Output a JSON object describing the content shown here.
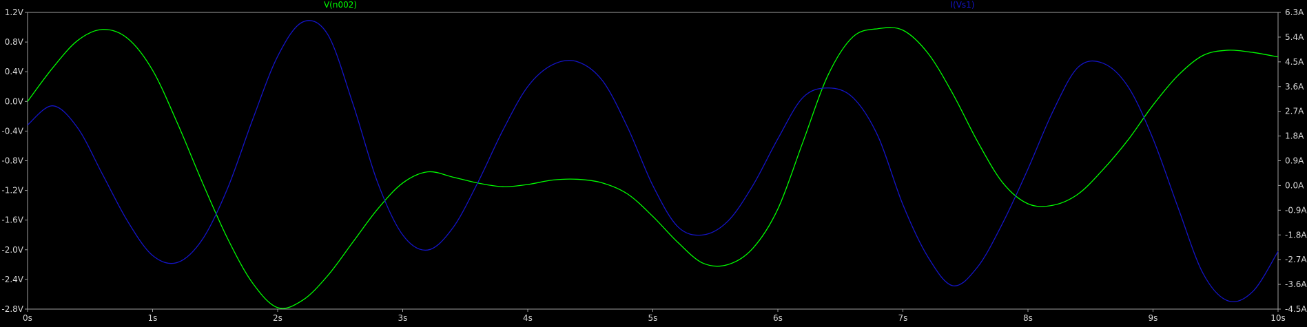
{
  "chart_data": {
    "type": "line",
    "background_color": "#000000",
    "grid": false,
    "x_axis": {
      "range": [
        0,
        10
      ],
      "tick_values": [
        0,
        1,
        2,
        3,
        4,
        5,
        6,
        7,
        8,
        9,
        10
      ],
      "tick_labels": [
        "0s",
        "1s",
        "2s",
        "3s",
        "4s",
        "5s",
        "6s",
        "7s",
        "8s",
        "9s",
        "10s"
      ]
    },
    "y_left": {
      "range": [
        -2.8,
        1.2
      ],
      "tick_values": [
        1.2,
        0.8,
        0.4,
        0.0,
        -0.4,
        -0.8,
        -1.2,
        -1.6,
        -2.0,
        -2.4,
        -2.8
      ],
      "tick_labels": [
        "1.2V",
        "0.8V",
        "0.4V",
        "0.0V",
        "-0.4V",
        "-0.8V",
        "-1.2V",
        "-1.6V",
        "-2.0V",
        "-2.4V",
        "-2.8V"
      ]
    },
    "y_right": {
      "range": [
        -4.5,
        6.3
      ],
      "tick_values": [
        6.3,
        5.4,
        4.5,
        3.6,
        2.7,
        1.8,
        0.9,
        0.0,
        -0.9,
        -1.8,
        -2.7,
        -3.6,
        -4.5
      ],
      "tick_labels": [
        "6.3A",
        "5.4A",
        "4.5A",
        "3.6A",
        "2.7A",
        "1.8A",
        "0.9A",
        "0.0A",
        "-0.9A",
        "-1.8A",
        "-2.7A",
        "-3.6A",
        "-4.5A"
      ]
    },
    "series": [
      {
        "name": "V(n002)",
        "axis": "left",
        "color": "#00ff00",
        "x": [
          0,
          0.2,
          0.4,
          0.6,
          0.8,
          1.0,
          1.2,
          1.4,
          1.6,
          1.8,
          2.0,
          2.2,
          2.4,
          2.6,
          2.8,
          3.0,
          3.2,
          3.4,
          3.6,
          3.8,
          4.0,
          4.2,
          4.4,
          4.6,
          4.8,
          5.0,
          5.2,
          5.4,
          5.6,
          5.8,
          6.0,
          6.2,
          6.4,
          6.6,
          6.8,
          7.0,
          7.2,
          7.4,
          7.6,
          7.8,
          8.0,
          8.2,
          8.4,
          8.6,
          8.8,
          9.0,
          9.2,
          9.4,
          9.6,
          9.8,
          10.0
        ],
        "y": [
          0.0,
          0.45,
          0.82,
          0.97,
          0.85,
          0.42,
          -0.3,
          -1.1,
          -1.85,
          -2.45,
          -2.78,
          -2.68,
          -2.35,
          -1.9,
          -1.45,
          -1.1,
          -0.95,
          -1.02,
          -1.1,
          -1.15,
          -1.12,
          -1.06,
          -1.05,
          -1.1,
          -1.25,
          -1.55,
          -1.9,
          -2.18,
          -2.2,
          -1.98,
          -1.45,
          -0.55,
          0.35,
          0.87,
          0.98,
          0.96,
          0.65,
          0.1,
          -0.55,
          -1.1,
          -1.38,
          -1.4,
          -1.25,
          -0.92,
          -0.52,
          -0.05,
          0.35,
          0.62,
          0.69,
          0.66,
          0.6
        ]
      },
      {
        "name": "I(Vs1)",
        "axis": "right",
        "color": "#1414c8",
        "x": [
          0,
          0.2,
          0.4,
          0.6,
          0.8,
          1.0,
          1.2,
          1.4,
          1.6,
          1.8,
          2.0,
          2.2,
          2.4,
          2.6,
          2.8,
          3.0,
          3.2,
          3.4,
          3.6,
          3.8,
          4.0,
          4.2,
          4.4,
          4.6,
          4.8,
          5.0,
          5.2,
          5.4,
          5.6,
          5.8,
          6.0,
          6.2,
          6.4,
          6.6,
          6.8,
          7.0,
          7.2,
          7.4,
          7.6,
          7.8,
          8.0,
          8.2,
          8.4,
          8.6,
          8.8,
          9.0,
          9.2,
          9.4,
          9.6,
          9.8,
          10.0
        ],
        "y": [
          2.2,
          2.9,
          2.1,
          0.4,
          -1.3,
          -2.55,
          -2.8,
          -1.95,
          -0.1,
          2.4,
          4.7,
          5.95,
          5.5,
          3.0,
          0.1,
          -1.8,
          -2.35,
          -1.55,
          0.1,
          2.0,
          3.6,
          4.4,
          4.5,
          3.8,
          2.1,
          0.0,
          -1.5,
          -1.8,
          -1.3,
          0.0,
          1.7,
          3.2,
          3.55,
          3.2,
          1.8,
          -0.7,
          -2.6,
          -3.65,
          -2.95,
          -1.35,
          0.6,
          2.7,
          4.3,
          4.45,
          3.6,
          1.7,
          -0.8,
          -3.2,
          -4.2,
          -3.85,
          -2.4
        ]
      }
    ]
  }
}
